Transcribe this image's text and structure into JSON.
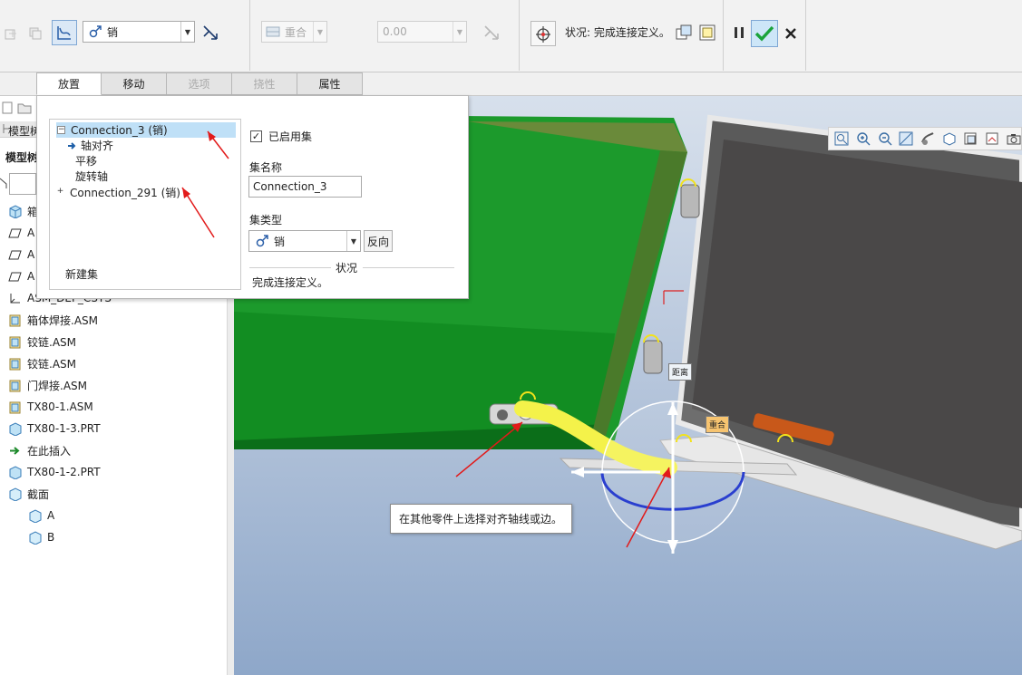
{
  "dashboard": {
    "connection_type": "销",
    "constraint_type": "重合",
    "offset_value": "0.00",
    "status_text": "状况: 完成连接定义。",
    "icons": [
      "point-icon",
      "copy-icon",
      "flexible-mode-icon",
      "flip-icon",
      "offset-toggle-icon",
      "move-dragger-icon",
      "separate-window-icon",
      "component-window-icon",
      "pause-icon",
      "ok-check-icon",
      "cancel-x-icon"
    ],
    "colors": {
      "ok": "#1aa33b",
      "active_btn": "#dbe8f6"
    }
  },
  "tabs": [
    {
      "label": "放置",
      "state": "active"
    },
    {
      "label": "移动",
      "state": "normal"
    },
    {
      "label": "选项",
      "state": "disabled"
    },
    {
      "label": "挠性",
      "state": "disabled"
    },
    {
      "label": "属性",
      "state": "normal"
    }
  ],
  "placement": {
    "sets": [
      {
        "label": "Connection_3 (销)",
        "expander": "−",
        "selected": true
      },
      {
        "label": "轴对齐",
        "child": true,
        "current": true
      },
      {
        "label": "平移",
        "child": true
      },
      {
        "label": "旋转轴",
        "child": true
      },
      {
        "label": "Connection_291 (销)",
        "expander": "+"
      }
    ],
    "new_set": "新建集",
    "enabled_label": "已启用集",
    "enabled": true,
    "set_name_label": "集名称",
    "set_name_value": "Connection_3",
    "set_type_label": "集类型",
    "set_type_value": "销",
    "flip_button": "反向",
    "status_header": "状况",
    "status_text": "完成连接定义。"
  },
  "model_tree": {
    "partial_labels": [
      "模型树",
      "模型树"
    ],
    "items": [
      {
        "label": "箱体",
        "icon": "assembly-icon"
      },
      {
        "label": "A",
        "icon": "datum-plane-icon"
      },
      {
        "label": "A",
        "icon": "datum-plane-icon"
      },
      {
        "label": "A",
        "icon": "datum-plane-icon"
      },
      {
        "label": "ASM_DEF_CSYS",
        "icon": "csys-icon"
      },
      {
        "label": "箱体焊接.ASM",
        "icon": "assembly-icon"
      },
      {
        "label": "铰链.ASM",
        "icon": "assembly-icon"
      },
      {
        "label": "铰链.ASM",
        "icon": "assembly-icon"
      },
      {
        "label": "门焊接.ASM",
        "icon": "assembly-icon"
      },
      {
        "label": "TX80-1.ASM",
        "icon": "assembly-icon"
      },
      {
        "label": "TX80-1-3.PRT",
        "icon": "part-icon"
      },
      {
        "label": "在此插入",
        "icon": "insert-here-arrow-icon"
      },
      {
        "label": "TX80-1-2.PRT",
        "icon": "part-icon"
      },
      {
        "label": "截面",
        "icon": "section-folder-icon"
      },
      {
        "label": "A",
        "icon": "section-icon"
      },
      {
        "label": "B",
        "icon": "section-icon"
      }
    ]
  },
  "viewport": {
    "tooltip": "在其他零件上选择对齐轴线或边。",
    "tag_distance": "距离",
    "tag_coincident": "重合",
    "toolbar_icons": [
      "zoom-fit-icon",
      "zoom-in-icon",
      "zoom-out-icon",
      "repaint-icon",
      "display-style-icon",
      "saved-view-icon",
      "view-manager-icon",
      "datum-display-icon",
      "camera-icon"
    ]
  }
}
